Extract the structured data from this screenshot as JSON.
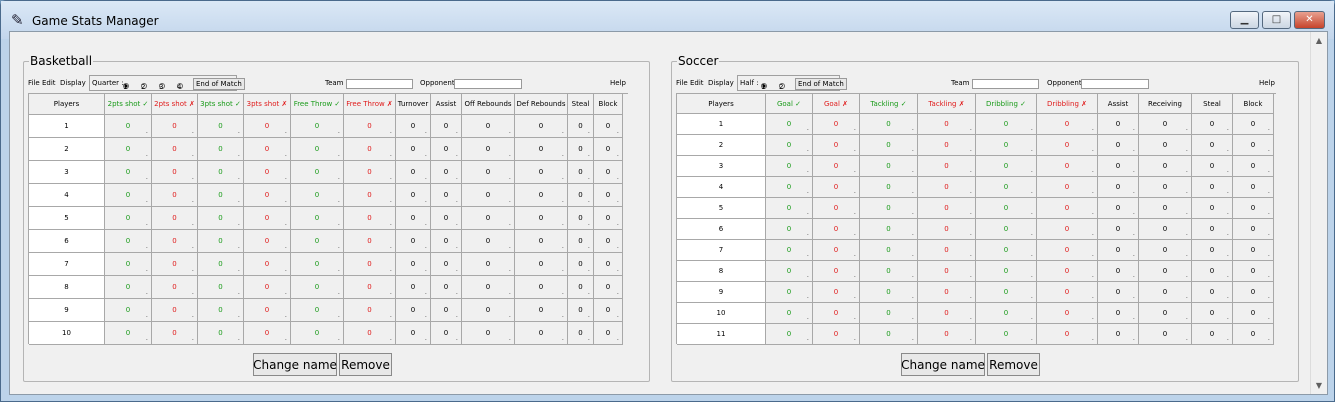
{
  "window": {
    "title": "Game Stats Manager",
    "buttons": {
      "minimize": "▁",
      "maximize": "□",
      "close": "✕"
    }
  },
  "icons": {
    "app": "feather-icon",
    "scroll_up": "▲",
    "scroll_down": "▼"
  },
  "colors": {
    "made": "#1a9b1a",
    "missed": "#e01b1b"
  },
  "basketball": {
    "legend": "Basketball",
    "menu": [
      "File",
      "Edit",
      "Display"
    ],
    "period_label": "Quarter :",
    "period_options": [
      "1",
      "2",
      "3",
      "4"
    ],
    "period_selected": "1",
    "end_of_match": "End of Match",
    "team_label": "Team :",
    "team_value": "",
    "opponent_label": "Opponent :",
    "opponent_value": "",
    "help": "Help",
    "players_header": "Players",
    "columns": [
      {
        "label": "2pts shot ✓",
        "tone": "green"
      },
      {
        "label": "2pts shot ✗",
        "tone": "red"
      },
      {
        "label": "3pts shot ✓",
        "tone": "green"
      },
      {
        "label": "3pts shot ✗",
        "tone": "red"
      },
      {
        "label": "Free Throw ✓",
        "tone": "green"
      },
      {
        "label": "Free Throw ✗",
        "tone": "red"
      },
      {
        "label": "Turnover",
        "tone": "black"
      },
      {
        "label": "Assist",
        "tone": "black"
      },
      {
        "label": "Off Rebounds",
        "tone": "black"
      },
      {
        "label": "Def Rebounds",
        "tone": "black"
      },
      {
        "label": "Steal",
        "tone": "black"
      },
      {
        "label": "Block",
        "tone": "black"
      }
    ],
    "players": [
      "1",
      "2",
      "3",
      "4",
      "5",
      "6",
      "7",
      "8",
      "9",
      "10"
    ],
    "cell_value": "0",
    "cell_marker": ".",
    "change_name": "Change name",
    "remove": "Remove"
  },
  "soccer": {
    "legend": "Soccer",
    "menu": [
      "File",
      "Edit",
      "Display"
    ],
    "period_label": "Half :",
    "period_options": [
      "1",
      "2"
    ],
    "period_selected": "1",
    "end_of_match": "End of Match",
    "team_label": "Team :",
    "team_value": "",
    "opponent_label": "Opponent :",
    "opponent_value": "",
    "help": "Help",
    "players_header": "Players",
    "columns": [
      {
        "label": "Goal ✓",
        "tone": "green"
      },
      {
        "label": "Goal ✗",
        "tone": "red"
      },
      {
        "label": "Tackling ✓",
        "tone": "green"
      },
      {
        "label": "Tackling ✗",
        "tone": "red"
      },
      {
        "label": "Dribbling ✓",
        "tone": "green"
      },
      {
        "label": "Dribbling ✗",
        "tone": "red"
      },
      {
        "label": "Assist",
        "tone": "black"
      },
      {
        "label": "Receiving",
        "tone": "black"
      },
      {
        "label": "Steal",
        "tone": "black"
      },
      {
        "label": "Block",
        "tone": "black"
      }
    ],
    "players": [
      "1",
      "2",
      "3",
      "4",
      "5",
      "6",
      "7",
      "8",
      "9",
      "10",
      "11"
    ],
    "cell_value": "0",
    "cell_marker": ".",
    "change_name": "Change name",
    "remove": "Remove"
  }
}
